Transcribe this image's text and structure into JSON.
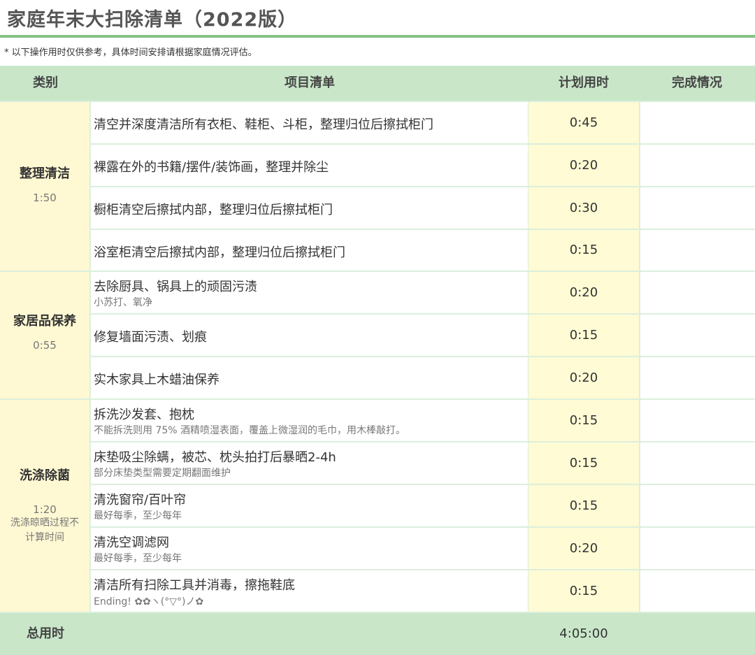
{
  "title": "家庭年末大扫除清单（2022版）",
  "note": "* 以下操作用时仅供参考，具体时间安排请根据家庭情况评估。",
  "headers": {
    "category": "类别",
    "items": "项目清单",
    "time": "计划用时",
    "status": "完成情况"
  },
  "groups": [
    {
      "name": "整理清洁",
      "time": "1:50",
      "items": [
        {
          "main": "清空并深度清洁所有衣柜、鞋柜、斗柜，整理归位后擦拭柜门",
          "time": "0:45"
        },
        {
          "main": "裸露在外的书籍/摆件/装饰画，整理并除尘",
          "time": "0:20"
        },
        {
          "main": "橱柜清空后擦拭内部，整理归位后擦拭柜门",
          "time": "0:30"
        },
        {
          "main": "浴室柜清空后擦拭内部，整理归位后擦拭柜门",
          "time": "0:15"
        }
      ]
    },
    {
      "name": "家居品保养",
      "time": "0:55",
      "items": [
        {
          "main": "去除厨具、锅具上的顽固污渍",
          "sub": "小苏打、氧净",
          "time": "0:20"
        },
        {
          "main": "修复墙面污渍、划痕",
          "time": "0:15"
        },
        {
          "main": "实木家具上木蜡油保养",
          "time": "0:20"
        }
      ]
    },
    {
      "name": "洗涤除菌",
      "time": "1:20",
      "note_line1": "洗涤晾晒过程不",
      "note_line2": "计算时间",
      "items": [
        {
          "main": "拆洗沙发套、抱枕",
          "sub": "不能拆洗则用 75% 酒精喷湿表面，覆盖上微湿润的毛巾，用木棒敲打。",
          "time": "0:15"
        },
        {
          "main": "床垫吸尘除螨，被芯、枕头拍打后暴晒2-4h",
          "sub": "部分床垫类型需要定期翻面维护",
          "time": "0:15"
        },
        {
          "main": "清洗窗帘/百叶帘",
          "sub": "最好每季，至少每年",
          "time": "0:15"
        },
        {
          "main": "清洗空调滤网",
          "sub": "最好每季，至少每年",
          "time": "0:20"
        },
        {
          "main": "清洁所有扫除工具并消毒，擦拖鞋底",
          "sub": "Ending! ✿✿ヽ(°▽°)ノ✿",
          "time": "0:15"
        }
      ]
    }
  ],
  "total": {
    "label": "总用时",
    "time": "4:05:00"
  },
  "colors": {
    "accent_green": "#86c286",
    "header_green": "#c9e6c9",
    "category_yellow": "#fef8d3",
    "time_yellow": "#fefbd5"
  }
}
